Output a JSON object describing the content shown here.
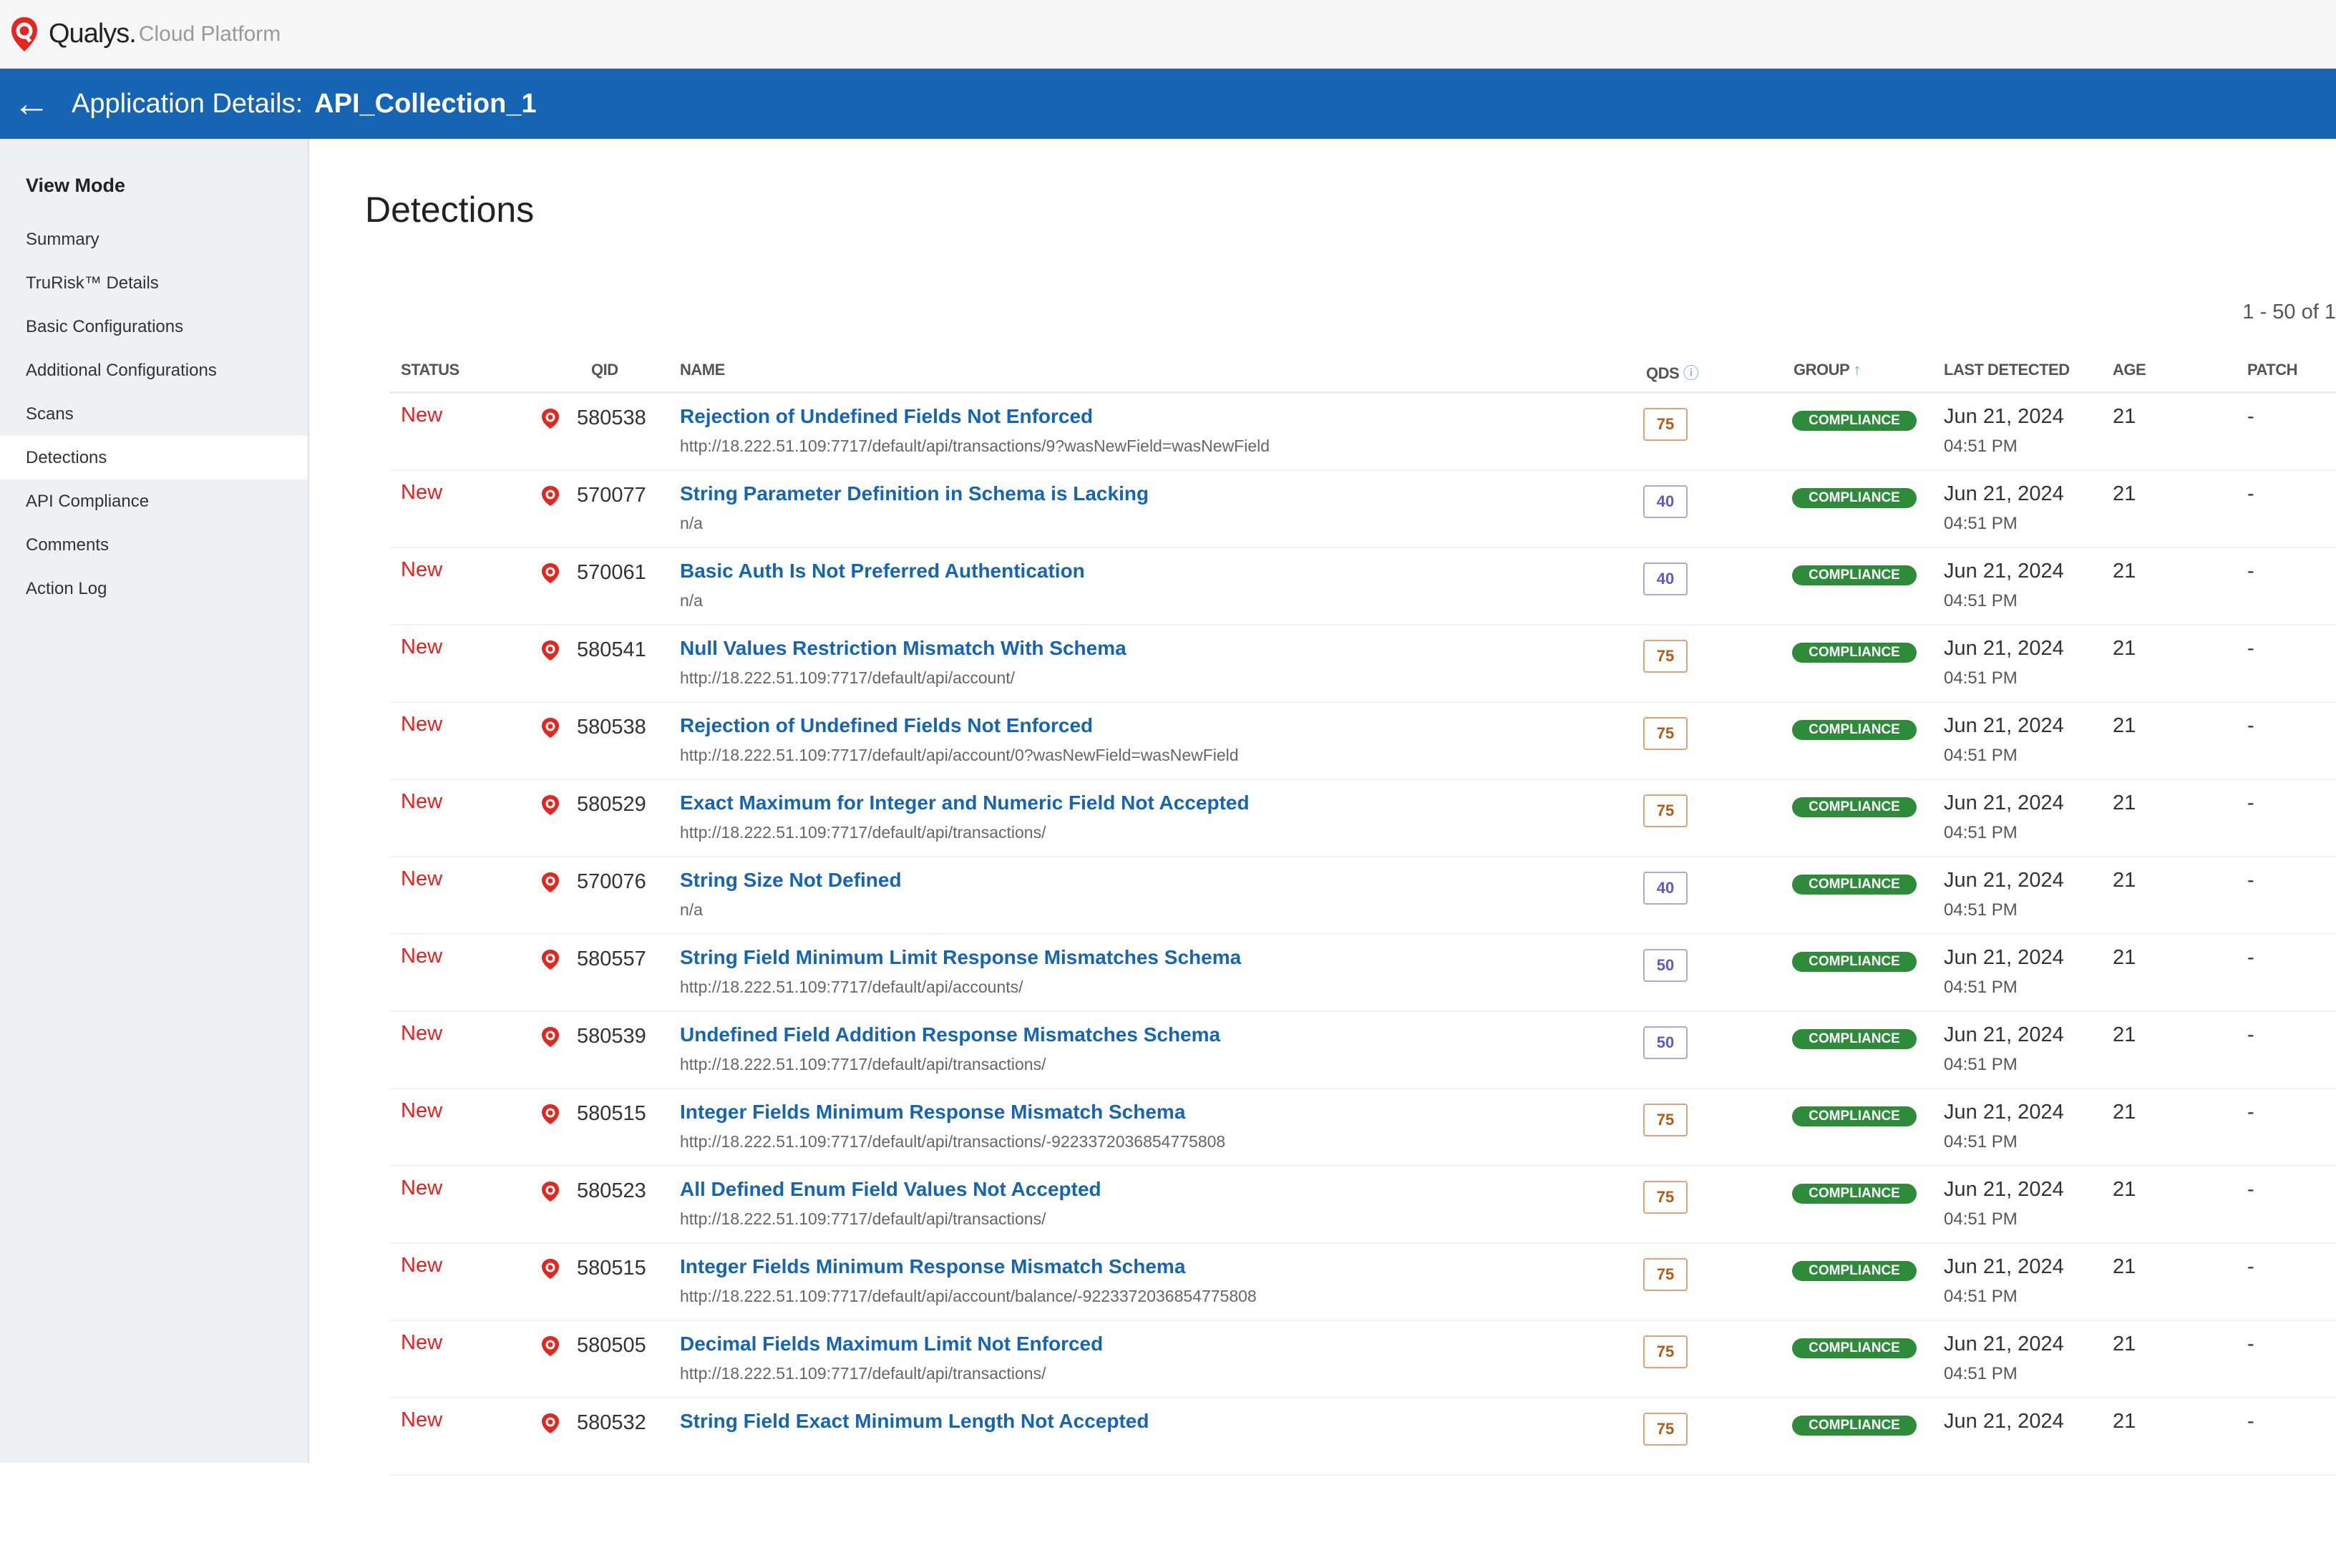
{
  "brand": {
    "name": "Qualys.",
    "sub": "Cloud Platform"
  },
  "header": {
    "label": "Application Details:",
    "app_name": "API_Collection_1"
  },
  "sidebar": {
    "title": "View Mode",
    "items": [
      {
        "label": "Summary"
      },
      {
        "label": "TruRisk™ Details"
      },
      {
        "label": "Basic Configurations"
      },
      {
        "label": "Additional Configurations"
      },
      {
        "label": "Scans"
      },
      {
        "label": "Detections",
        "active": true
      },
      {
        "label": "API Compliance"
      },
      {
        "label": "Comments"
      },
      {
        "label": "Action Log"
      }
    ]
  },
  "main": {
    "title": "Detections",
    "pagination": "1 - 50 of 1",
    "columns": {
      "status": "STATUS",
      "qid": "QID",
      "name": "NAME",
      "qds": "QDS",
      "group": "GROUP",
      "last_detected": "LAST DETECTED",
      "age": "AGE",
      "patch": "PATCH"
    },
    "rows": [
      {
        "status": "New",
        "qid": "580538",
        "name": "Rejection of Undefined Fields Not Enforced",
        "url": "http://18.222.51.109:7717/default/api/transactions/9?wasNewField=wasNewField",
        "qds": "75",
        "group": "COMPLIANCE",
        "date": "Jun 21, 2024",
        "time": "04:51 PM",
        "age": "21",
        "patch": "-"
      },
      {
        "status": "New",
        "qid": "570077",
        "name": "String Parameter Definition in Schema is Lacking",
        "url": "n/a",
        "qds": "40",
        "group": "COMPLIANCE",
        "date": "Jun 21, 2024",
        "time": "04:51 PM",
        "age": "21",
        "patch": "-"
      },
      {
        "status": "New",
        "qid": "570061",
        "name": "Basic Auth Is Not Preferred Authentication",
        "url": "n/a",
        "qds": "40",
        "group": "COMPLIANCE",
        "date": "Jun 21, 2024",
        "time": "04:51 PM",
        "age": "21",
        "patch": "-"
      },
      {
        "status": "New",
        "qid": "580541",
        "name": "Null Values Restriction Mismatch With Schema",
        "url": "http://18.222.51.109:7717/default/api/account/",
        "qds": "75",
        "group": "COMPLIANCE",
        "date": "Jun 21, 2024",
        "time": "04:51 PM",
        "age": "21",
        "patch": "-"
      },
      {
        "status": "New",
        "qid": "580538",
        "name": "Rejection of Undefined Fields Not Enforced",
        "url": "http://18.222.51.109:7717/default/api/account/0?wasNewField=wasNewField",
        "qds": "75",
        "group": "COMPLIANCE",
        "date": "Jun 21, 2024",
        "time": "04:51 PM",
        "age": "21",
        "patch": "-"
      },
      {
        "status": "New",
        "qid": "580529",
        "name": "Exact Maximum for Integer and Numeric Field Not Accepted",
        "url": "http://18.222.51.109:7717/default/api/transactions/",
        "qds": "75",
        "group": "COMPLIANCE",
        "date": "Jun 21, 2024",
        "time": "04:51 PM",
        "age": "21",
        "patch": "-"
      },
      {
        "status": "New",
        "qid": "570076",
        "name": "String Size Not Defined",
        "url": "n/a",
        "qds": "40",
        "group": "COMPLIANCE",
        "date": "Jun 21, 2024",
        "time": "04:51 PM",
        "age": "21",
        "patch": "-"
      },
      {
        "status": "New",
        "qid": "580557",
        "name": "String Field Minimum Limit Response Mismatches Schema",
        "url": "http://18.222.51.109:7717/default/api/accounts/",
        "qds": "50",
        "group": "COMPLIANCE",
        "date": "Jun 21, 2024",
        "time": "04:51 PM",
        "age": "21",
        "patch": "-"
      },
      {
        "status": "New",
        "qid": "580539",
        "name": "Undefined Field Addition Response Mismatches Schema",
        "url": "http://18.222.51.109:7717/default/api/transactions/",
        "qds": "50",
        "group": "COMPLIANCE",
        "date": "Jun 21, 2024",
        "time": "04:51 PM",
        "age": "21",
        "patch": "-"
      },
      {
        "status": "New",
        "qid": "580515",
        "name": "Integer Fields Minimum Response Mismatch Schema",
        "url": "http://18.222.51.109:7717/default/api/transactions/-9223372036854775808",
        "qds": "75",
        "group": "COMPLIANCE",
        "date": "Jun 21, 2024",
        "time": "04:51 PM",
        "age": "21",
        "patch": "-"
      },
      {
        "status": "New",
        "qid": "580523",
        "name": "All Defined Enum Field Values Not Accepted",
        "url": "http://18.222.51.109:7717/default/api/transactions/",
        "qds": "75",
        "group": "COMPLIANCE",
        "date": "Jun 21, 2024",
        "time": "04:51 PM",
        "age": "21",
        "patch": "-"
      },
      {
        "status": "New",
        "qid": "580515",
        "name": "Integer Fields Minimum Response Mismatch Schema",
        "url": "http://18.222.51.109:7717/default/api/account/balance/-9223372036854775808",
        "qds": "75",
        "group": "COMPLIANCE",
        "date": "Jun 21, 2024",
        "time": "04:51 PM",
        "age": "21",
        "patch": "-"
      },
      {
        "status": "New",
        "qid": "580505",
        "name": "Decimal Fields Maximum Limit Not Enforced",
        "url": "http://18.222.51.109:7717/default/api/transactions/",
        "qds": "75",
        "group": "COMPLIANCE",
        "date": "Jun 21, 2024",
        "time": "04:51 PM",
        "age": "21",
        "patch": "-"
      },
      {
        "status": "New",
        "qid": "580532",
        "name": "String Field Exact Minimum Length Not Accepted",
        "url": "",
        "qds": "75",
        "group": "COMPLIANCE",
        "date": "Jun 21, 2024",
        "time": "",
        "age": "21",
        "patch": "-"
      }
    ]
  },
  "colors": {
    "brand_blue": "#1565b4",
    "status_new": "#e8201c",
    "compliance": "#2e8b3a"
  }
}
